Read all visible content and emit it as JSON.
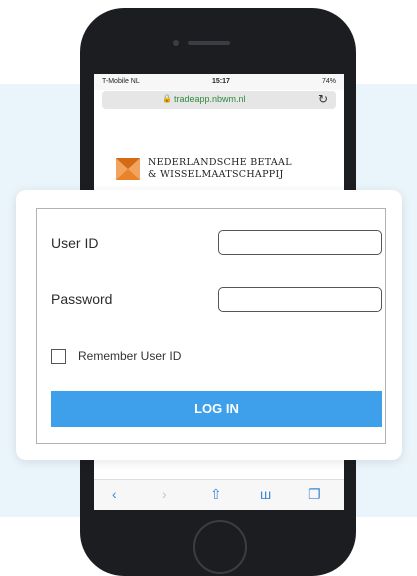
{
  "statusbar": {
    "carrier": "T-Mobile NL",
    "time": "15:17",
    "battery": "74%"
  },
  "browser": {
    "url": "tradeapp.nbwm.nl",
    "lock_icon": "lock-icon",
    "reload_icon": "reload-icon"
  },
  "brand": {
    "line1": "NEDERLANDSCHE BETAAL",
    "line2": "& WISSELMAATSCHAPPIJ",
    "logo_color": "#e8832a"
  },
  "login": {
    "user_id_label": "User ID",
    "user_id_value": "",
    "password_label": "Password",
    "password_value": "",
    "remember_label": "Remember User ID",
    "remember_checked": false,
    "login_button": "LOG IN",
    "button_color": "#3ea0ea"
  },
  "toolbar": {
    "items": [
      "back-icon",
      "forward-icon",
      "share-icon",
      "bookmarks-icon",
      "tabs-icon"
    ]
  }
}
